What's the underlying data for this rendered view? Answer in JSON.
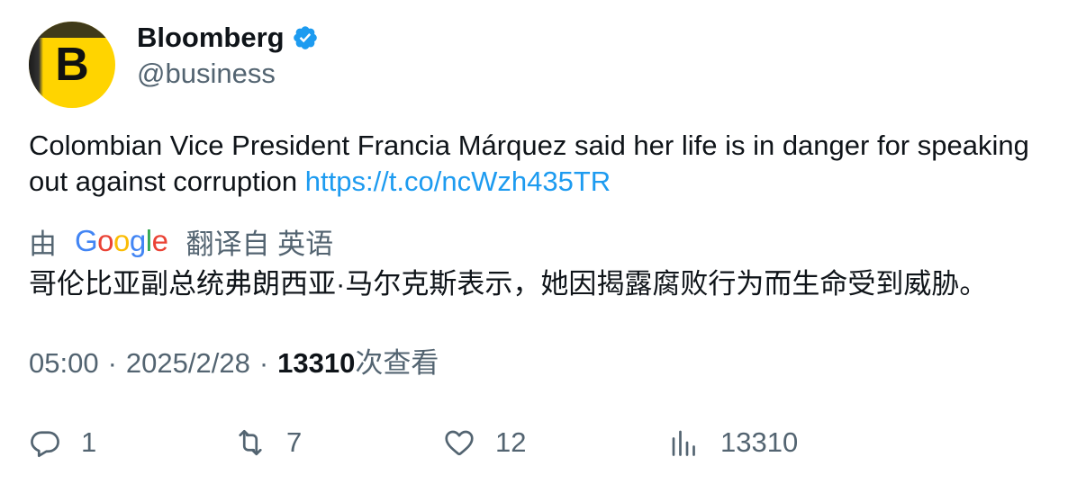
{
  "author": {
    "display_name": "Bloomberg",
    "handle": "@business",
    "avatar_letter": "B",
    "avatar_color": "#ffd400",
    "verified_icon": "verified-badge-icon",
    "verified_color": "#1d9bf0"
  },
  "tweet": {
    "text": "Colombian Vice President Francia Márquez said her life is in danger for speaking out against corruption ",
    "link": "https://t.co/ncWzh435TR",
    "link_color": "#1d9bf0"
  },
  "translation": {
    "prefix": "由",
    "provider": "Google",
    "suffix": "翻译自 英语",
    "text": "哥伦比亚副总统弗朗西亚·马尔克斯表示，她因揭露腐败行为而生命受到威胁。"
  },
  "meta": {
    "time": "05:00",
    "separator": "·",
    "date": "2025/2/28",
    "views_count": "13310",
    "views_label": "次查看"
  },
  "actions": {
    "reply": {
      "icon": "reply-icon",
      "count": "1"
    },
    "retweet": {
      "icon": "retweet-icon",
      "count": "7"
    },
    "like": {
      "icon": "heart-icon",
      "count": "12"
    },
    "views": {
      "icon": "views-chart-icon",
      "count": "13310"
    }
  }
}
